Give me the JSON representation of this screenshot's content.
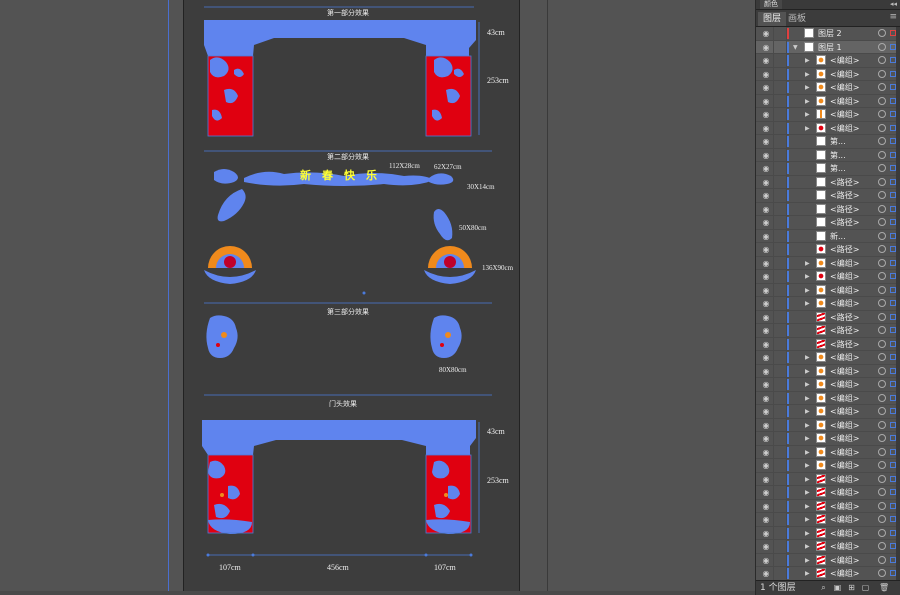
{
  "artboard": {
    "section_titles": [
      "第一部分效果",
      "第二部分效果",
      "第三部分效果",
      "门头效果"
    ],
    "dimensions": {
      "top_43": "43cm",
      "top_253": "253cm",
      "size_112": "112X28cm",
      "size_62": "62X27cm",
      "size_30": "30X14cm",
      "size_50": "50X80cm",
      "size_136": "136X90cm",
      "size_80": "80X80cm",
      "bottom_43": "43cm",
      "bottom_253": "253cm",
      "w_107_left": "107cm",
      "w_456": "456cm",
      "w_107_right": "107cm"
    },
    "banner_chars": [
      "新",
      "春",
      "快",
      "乐"
    ]
  },
  "panel": {
    "collapsed_tab": "颜色",
    "collapsed_arrows": "◂◂",
    "tabs": [
      "图层",
      "画板"
    ],
    "menu_icon": "≡",
    "footer_label": "1 个图层",
    "layers": [
      {
        "name": "图层 2",
        "level": 0,
        "expand": false,
        "thumb": "white",
        "bar": "#e04040",
        "top": true
      },
      {
        "name": "图层 1",
        "level": 0,
        "expand": true,
        "thumb": "white",
        "bar": "#4a7bdc",
        "active": true
      },
      {
        "name": "<编组>",
        "level": 1,
        "expand": true,
        "thumb": "orange"
      },
      {
        "name": "<编组>",
        "level": 1,
        "expand": true,
        "thumb": "orange"
      },
      {
        "name": "<编组>",
        "level": 1,
        "expand": true,
        "thumb": "orange"
      },
      {
        "name": "<编组>",
        "level": 1,
        "expand": true,
        "thumb": "orange"
      },
      {
        "name": "<编组>",
        "level": 1,
        "expand": true,
        "thumb": "mixed"
      },
      {
        "name": "<编组>",
        "level": 1,
        "expand": true,
        "thumb": "red"
      },
      {
        "name": "第...",
        "level": 1,
        "expand": false,
        "thumb": "white"
      },
      {
        "name": "第...",
        "level": 1,
        "expand": false,
        "thumb": "white"
      },
      {
        "name": "第...",
        "level": 1,
        "expand": false,
        "thumb": "white"
      },
      {
        "name": "<路径>",
        "level": 1,
        "expand": false,
        "thumb": "white"
      },
      {
        "name": "<路径>",
        "level": 1,
        "expand": false,
        "thumb": "white"
      },
      {
        "name": "<路径>",
        "level": 1,
        "expand": false,
        "thumb": "white"
      },
      {
        "name": "<路径>",
        "level": 1,
        "expand": false,
        "thumb": "white"
      },
      {
        "name": "新...",
        "level": 1,
        "expand": false,
        "thumb": "white"
      },
      {
        "name": "<路径>",
        "level": 1,
        "expand": false,
        "thumb": "red"
      },
      {
        "name": "<编组>",
        "level": 1,
        "expand": true,
        "thumb": "orange"
      },
      {
        "name": "<编组>",
        "level": 1,
        "expand": true,
        "thumb": "red"
      },
      {
        "name": "<编组>",
        "level": 1,
        "expand": true,
        "thumb": "orange"
      },
      {
        "name": "<编组>",
        "level": 1,
        "expand": true,
        "thumb": "orange"
      },
      {
        "name": "<路径>",
        "level": 1,
        "expand": false,
        "thumb": "stripe"
      },
      {
        "name": "<路径>",
        "level": 1,
        "expand": false,
        "thumb": "stripe"
      },
      {
        "name": "<路径>",
        "level": 1,
        "expand": false,
        "thumb": "stripe"
      },
      {
        "name": "<编组>",
        "level": 1,
        "expand": true,
        "thumb": "orange"
      },
      {
        "name": "<编组>",
        "level": 1,
        "expand": true,
        "thumb": "orange"
      },
      {
        "name": "<编组>",
        "level": 1,
        "expand": true,
        "thumb": "orange"
      },
      {
        "name": "<编组>",
        "level": 1,
        "expand": true,
        "thumb": "orange"
      },
      {
        "name": "<编组>",
        "level": 1,
        "expand": true,
        "thumb": "orange"
      },
      {
        "name": "<编组>",
        "level": 1,
        "expand": true,
        "thumb": "orange"
      },
      {
        "name": "<编组>",
        "level": 1,
        "expand": true,
        "thumb": "orange"
      },
      {
        "name": "<编组>",
        "level": 1,
        "expand": true,
        "thumb": "orange"
      },
      {
        "name": "<编组>",
        "level": 1,
        "expand": true,
        "thumb": "orange"
      },
      {
        "name": "<编组>",
        "level": 1,
        "expand": true,
        "thumb": "stripe"
      },
      {
        "name": "<编组>",
        "level": 1,
        "expand": true,
        "thumb": "stripe"
      },
      {
        "name": "<编组>",
        "level": 1,
        "expand": true,
        "thumb": "stripe"
      },
      {
        "name": "<编组>",
        "level": 1,
        "expand": true,
        "thumb": "stripe"
      },
      {
        "name": "<编组>",
        "level": 1,
        "expand": true,
        "thumb": "stripe"
      },
      {
        "name": "<编组>",
        "level": 1,
        "expand": true,
        "thumb": "stripe"
      },
      {
        "name": "<编组>",
        "level": 1,
        "expand": true,
        "thumb": "stripe"
      },
      {
        "name": "<编组>",
        "level": 1,
        "expand": true,
        "thumb": "stripe"
      }
    ]
  },
  "colors": {
    "selection_blue": "#4a7bdc",
    "red": "#e00010",
    "orange": "#f08a1c",
    "yellow": "#ffff33",
    "layer2_bar": "#e04040"
  }
}
